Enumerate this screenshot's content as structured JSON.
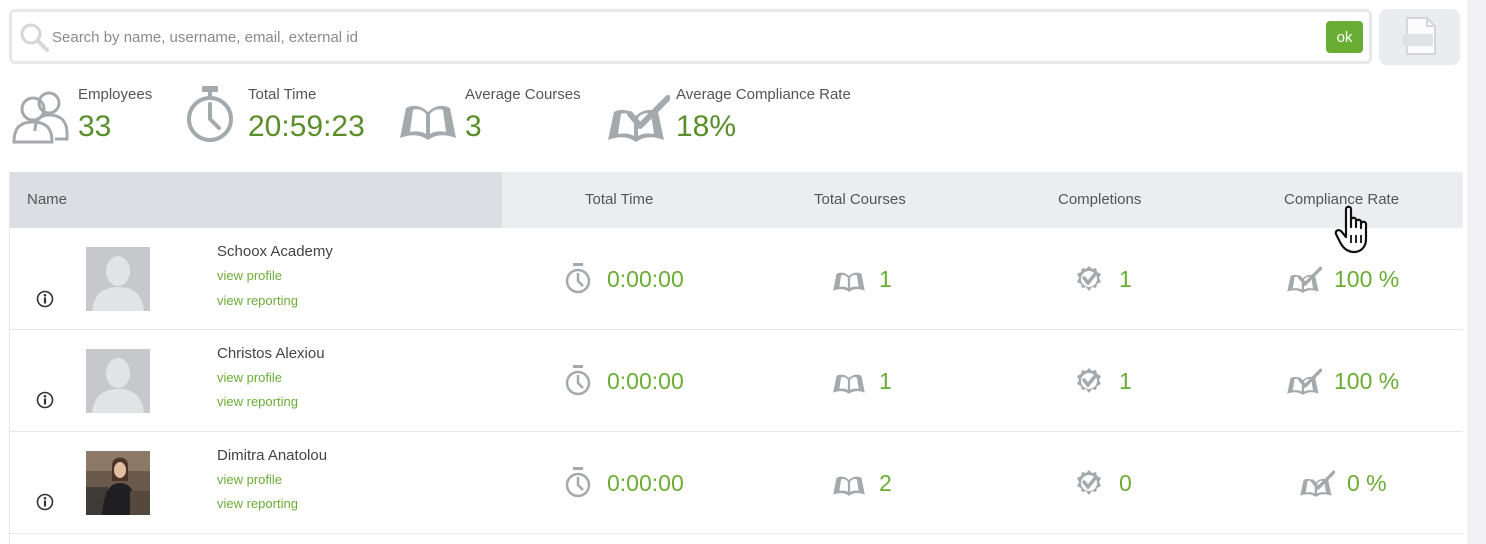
{
  "search": {
    "placeholder": "Search by name, username, email, external id",
    "submit_label": "ok"
  },
  "export": {
    "icon": "export-file-icon"
  },
  "stats": [
    {
      "label": "Employees",
      "value": "33",
      "icon": "employees-icon"
    },
    {
      "label": "Total Time",
      "value": "20:59:23",
      "icon": "stopwatch-icon"
    },
    {
      "label": "Average Courses",
      "value": "3",
      "icon": "open-book-icon"
    },
    {
      "label": "Average Compliance Rate",
      "value": "18%",
      "icon": "compliance-book-icon"
    }
  ],
  "table": {
    "columns": [
      "Name",
      "Total Time",
      "Total Courses",
      "Completions",
      "Compliance Rate"
    ],
    "rows": [
      {
        "name": "Schoox Academy",
        "view_profile": "view profile",
        "view_reporting": "view reporting",
        "total_time": "0:00:00",
        "total_courses": "1",
        "completions": "1",
        "compliance": "100 %",
        "avatar": "placeholder"
      },
      {
        "name": "Christos Alexiou",
        "view_profile": "view profile",
        "view_reporting": "view reporting",
        "total_time": "0:00:00",
        "total_courses": "1",
        "completions": "1",
        "compliance": "100 %",
        "avatar": "placeholder"
      },
      {
        "name": "Dimitra Anatolou",
        "view_profile": "view profile",
        "view_reporting": "view reporting",
        "total_time": "0:00:00",
        "total_courses": "2",
        "completions": "0",
        "compliance": "0 %",
        "avatar": "photo"
      }
    ]
  },
  "colors": {
    "accent": "#6aad35",
    "stat_value": "#5a8e2a",
    "icon_gray": "#a4a9ae"
  }
}
